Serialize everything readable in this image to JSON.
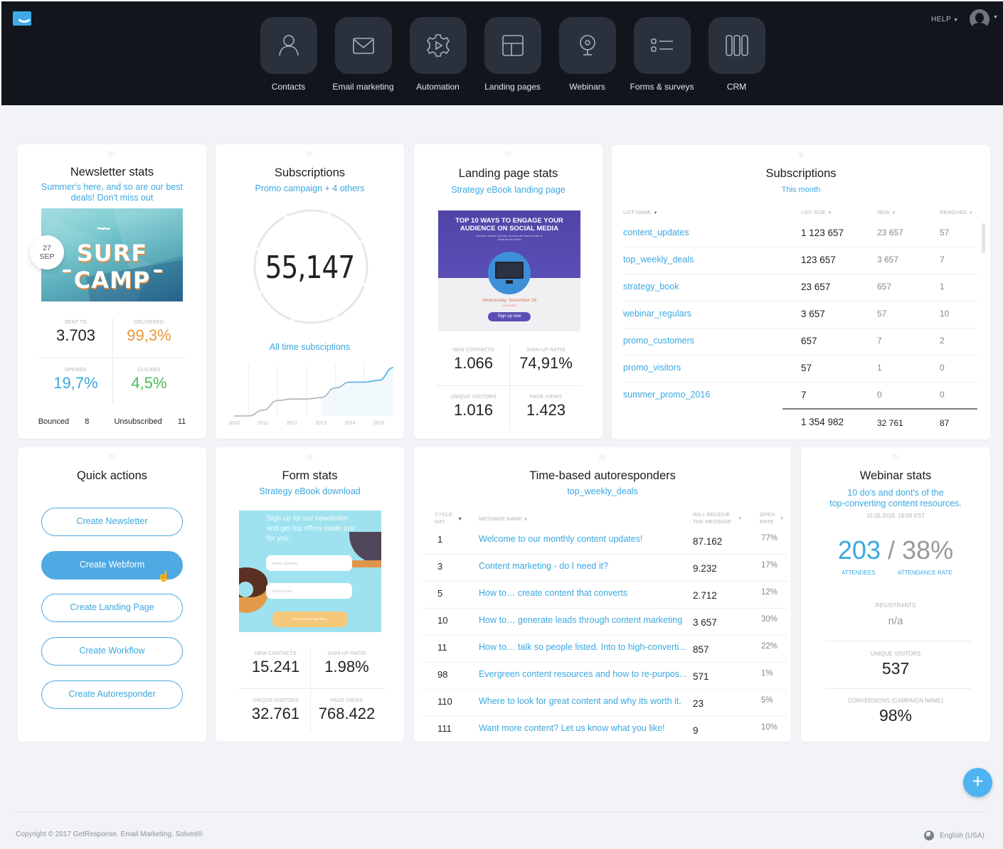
{
  "header": {
    "nav": [
      {
        "label": "Contacts",
        "icon": "person-icon"
      },
      {
        "label": "Email marketing",
        "icon": "envelope-icon"
      },
      {
        "label": "Automation",
        "icon": "gear-play-icon"
      },
      {
        "label": "Landing pages",
        "icon": "layout-icon"
      },
      {
        "label": "Webinars",
        "icon": "webcam-icon"
      },
      {
        "label": "Forms & surveys",
        "icon": "list-form-icon"
      },
      {
        "label": "CRM",
        "icon": "columns-icon"
      }
    ],
    "help_label": "HELP"
  },
  "newsletter": {
    "title": "Newsletter stats",
    "subtitle": "Summer's here, and so are our best deals! Don't miss out",
    "image_text": {
      "line1": "SURF",
      "line2": "CAMP"
    },
    "date_day": "27",
    "date_month": "SEP",
    "stats": [
      {
        "label": "SENT TO",
        "value": "3.703",
        "color": "#222222"
      },
      {
        "label": "DELIVERED",
        "value": "99,3%",
        "color": "#e8963a"
      },
      {
        "label": "OPENED",
        "value": "19,7%",
        "color": "#3aa8e0"
      },
      {
        "label": "CLICKED",
        "value": "4,5%",
        "color": "#4cbb5a"
      }
    ],
    "bounced_label": "Bounced",
    "bounced_value": "8",
    "unsubscribed_label": "Unsubscribed",
    "unsubscribed_value": "11"
  },
  "subscriptions_ring": {
    "title": "Subscriptions",
    "subtitle": "Promo campaign + 4 others",
    "total": "55,147",
    "caption": "All time subsciptions"
  },
  "chart_data": {
    "type": "line",
    "title": "All time subsciptions",
    "categories": [
      "2010",
      "2011",
      "2012",
      "2013",
      "2014",
      "2015"
    ],
    "x": [
      2010,
      2010.5,
      2011,
      2011.5,
      2012,
      2012.5,
      2013,
      2013.5,
      2014,
      2014.5,
      2015,
      2015.5
    ],
    "values": [
      0,
      0,
      12,
      32,
      35,
      35,
      38,
      58,
      70,
      70,
      74,
      100
    ],
    "highlight_from": 2013,
    "ylim": [
      0,
      100
    ],
    "grid": true,
    "xlabel": "",
    "ylabel": ""
  },
  "landing_page": {
    "title": "Landing page stats",
    "subtitle": "Strategy eBook landing page",
    "preview": {
      "headline": "TOP 10 WAYS TO ENGAGE YOUR AUDIENCE ON SOCIAL MEDIA",
      "sub": "Exclusive webinar with John Summers and Sandra Butler of Social Booster Media",
      "date": "Wednesday, November 26",
      "time": "1:00 PM EST",
      "button": "Sign up now"
    },
    "stats": [
      {
        "label": "NEW CONTACTS",
        "value": "1.066"
      },
      {
        "label": "SIGN-UP RATIO",
        "value": "74,91%"
      },
      {
        "label": "UNIQUE VISITORS",
        "value": "1.016"
      },
      {
        "label": "PAGE VIEWS",
        "value": "1.423"
      }
    ]
  },
  "subscriptions_table": {
    "title": "Subscriptions",
    "subtitle": "This month",
    "columns": [
      "LIST NAME",
      "LIST SIZE",
      "NEW",
      "REMOVED"
    ],
    "rows": [
      {
        "name": "content_updates",
        "size": "1 123 657",
        "new": "23 657",
        "removed": "57"
      },
      {
        "name": "top_weekly_deals",
        "size": "123 657",
        "new": "3 657",
        "removed": "7"
      },
      {
        "name": "strategy_book",
        "size": "23 657",
        "new": "657",
        "removed": "1"
      },
      {
        "name": "webinar_regulars",
        "size": "3 657",
        "new": "57",
        "removed": "10"
      },
      {
        "name": "promo_customers",
        "size": "657",
        "new": "7",
        "removed": "2"
      },
      {
        "name": "promo_visitors",
        "size": "57",
        "new": "1",
        "removed": "0"
      },
      {
        "name": "summer_promo_2016",
        "size": "7",
        "new": "0",
        "removed": "0"
      }
    ],
    "totals": {
      "size": "1 354 982",
      "new": "32 761",
      "removed": "87"
    }
  },
  "quick_actions": {
    "title": "Quick actions",
    "buttons": [
      "Create Newsletter",
      "Create Webform",
      "Create Landing Page",
      "Create Workflow",
      "Create Autoresponder"
    ]
  },
  "form_stats": {
    "title": "Form stats",
    "subtitle": "Strategy eBook download",
    "preview": {
      "headline": "Sign up for our newsletter and get top offers made just for you.",
      "email_placeholder": "EMAIL ADDRESS",
      "name_placeholder": "FIRST NAME",
      "button": "Send me your top offers"
    },
    "stats": [
      {
        "label": "NEW CONTACTS",
        "value": "15.241"
      },
      {
        "label": "SIGN-UP RATIO",
        "value": "1.98%"
      },
      {
        "label": "UNIQUE VISITORS",
        "value": "32.761"
      },
      {
        "label": "PAGE VIEWS",
        "value": "768.422"
      }
    ]
  },
  "autoresponders": {
    "title": "Time-based autoresponders",
    "subtitle": "top_weekly_deals",
    "columns": {
      "day": "CYCLE DAY",
      "message": "MESSAGE NAME",
      "will": "WILL RECEIVE THE MESSAGE",
      "rate": "OPEN RATE"
    },
    "rows": [
      {
        "day": "1",
        "message": "Welcome to our monthly content updates!",
        "will": "87.162",
        "rate": "77%"
      },
      {
        "day": "3",
        "message": "Content marketing - do I need it?",
        "will": "9.232",
        "rate": "17%"
      },
      {
        "day": "5",
        "message": "How to… create content that converts",
        "will": "2.712",
        "rate": "12%"
      },
      {
        "day": "10",
        "message": " How to… generate leads through content marketing",
        "will": "3 657",
        "rate": "30%"
      },
      {
        "day": "11",
        "message": "How to… talk so people listed. Into to high-converti...",
        "will": "857",
        "rate": "22%"
      },
      {
        "day": "98",
        "message": "Evergreen content resources and how to re-purpos...",
        "will": "571",
        "rate": "1%"
      },
      {
        "day": "110",
        "message": "Where to look for great content and why its worth it.",
        "will": "23",
        "rate": "5%"
      },
      {
        "day": "111",
        "message": "Want more content? Let us know what you like!",
        "will": "9",
        "rate": "10%"
      }
    ]
  },
  "webinar": {
    "title": "Webinar stats",
    "subtitle_line1": "10 do's and dont's of the",
    "subtitle_line2": "top-converting content resources.",
    "datetime": "15.05.2016, 18:00 EST",
    "attendees": "203",
    "separator": "/",
    "attendance_rate": "38%",
    "attendees_label": "ATTENDEES",
    "attendance_rate_label": "ATTENDANCE RATE",
    "registrants_label": "REGISTRANTS",
    "registrants_value": "n/a",
    "unique_visitors_label": "UNIQUE VISITORS",
    "unique_visitors_value": "537",
    "conversions_label": "CONVERSIONS (CAMPAIGN NAME)",
    "conversions_value": "98%"
  },
  "footer": {
    "copyright": "Copyright © 2017 GetResponse. Email Marketing. Solved®",
    "language": "English (USA)",
    "fab_label": "+"
  }
}
